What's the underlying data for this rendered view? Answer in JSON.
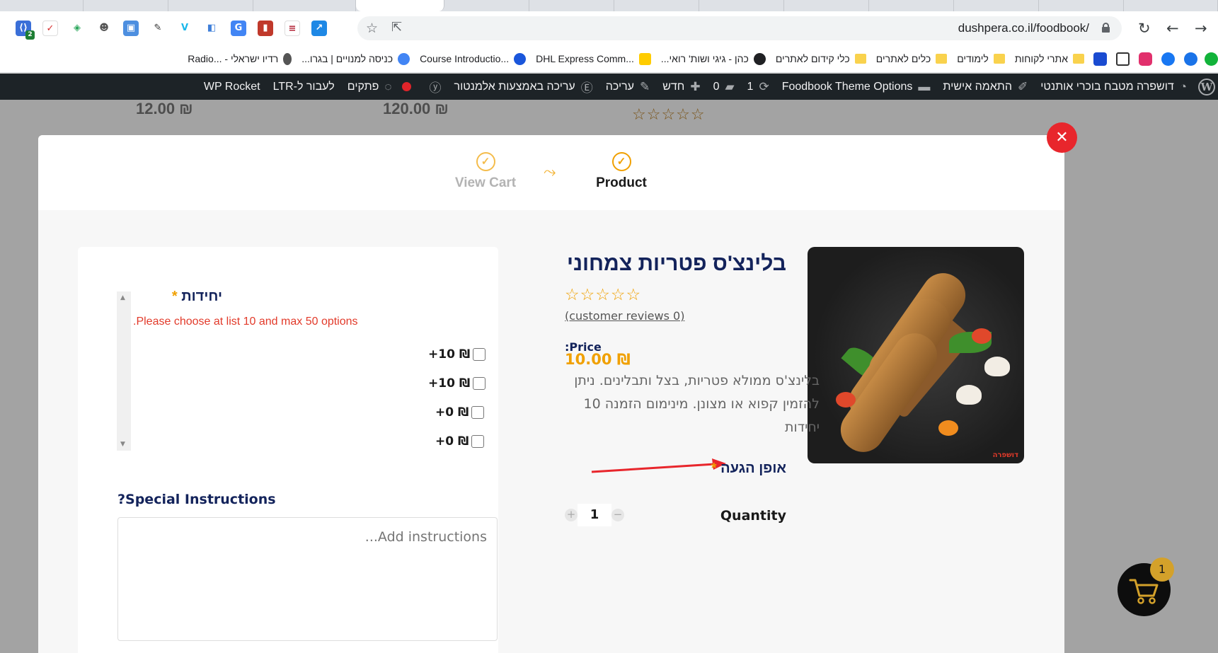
{
  "browser": {
    "url": "dushpera.co.il/foodbook/",
    "extension_badge": "2"
  },
  "bookmarks": [
    {
      "label": "רדיו ישראלי - ...Radio"
    },
    {
      "label": "כניסה למנויים | בגרו..."
    },
    {
      "label": "...Course Introductio"
    },
    {
      "label": "...DHL Express Comm"
    },
    {
      "label": "כהן - גיגי ושות' רואי..."
    },
    {
      "label": "כלי קידום לאתרים"
    },
    {
      "label": "כלים לאתרים"
    },
    {
      "label": "לימודים"
    },
    {
      "label": "אתרי לקוחות"
    }
  ],
  "wp_admin_bar": {
    "site_name": "דושפרה מטבח בוכרי אותנטי",
    "customize": "התאמה אישית",
    "theme_options": "Foodbook Theme Options",
    "updates_count": "1",
    "comments_count": "0",
    "new": "חדש",
    "edit": "עריכה",
    "elementor_edit": "עריכה באמצעות אלמנטור",
    "notes": "פתקים",
    "ltr_toggle": "לעבור ל-LTR",
    "wp_rocket": "WP Rocket"
  },
  "background_prices": [
    "12.00 ₪",
    "120.00 ₪"
  ],
  "background_stars": "☆☆☆☆☆",
  "modal": {
    "steps": [
      {
        "label": "View Cart",
        "state": "done"
      },
      {
        "label": "Product",
        "state": "current"
      }
    ],
    "step_check_icon": "✓",
    "close_icon": "✕",
    "product": {
      "title": "בלינצ'ס פטריות צמחוני",
      "stars": "☆☆☆☆☆",
      "reviews_link": "(customer reviews 0)",
      "price_label": ":Price",
      "price": "10.00 ₪",
      "description": "בלינצ'ס ממולא פטריות, בצל ותבלינים. ניתן להזמין קפוא או מצונן. מינימום הזמנה 10 יחידות",
      "delivery_label": "אופן הגעה",
      "required_mark": "*",
      "quantity_label": "Quantity",
      "quantity_value": "1",
      "image_logo": "דושפרה"
    },
    "options": {
      "title": "יחידות",
      "required_mark": "*",
      "error": ".Please choose at list 10 and max 50 options",
      "items": [
        {
          "label": "+10 ₪",
          "checked": false
        },
        {
          "label": "+10 ₪",
          "checked": false
        },
        {
          "label": "+0 ₪",
          "checked": false
        },
        {
          "label": "+0 ₪",
          "checked": false
        }
      ]
    },
    "special_instructions": {
      "title": "?Special Instructions",
      "placeholder": "...Add instructions"
    }
  },
  "cart": {
    "count": "1"
  },
  "colors": {
    "accent": "#f0a000",
    "brand_navy": "#13235b",
    "close_red": "#e8262c",
    "wp_bar": "#1d2327"
  }
}
